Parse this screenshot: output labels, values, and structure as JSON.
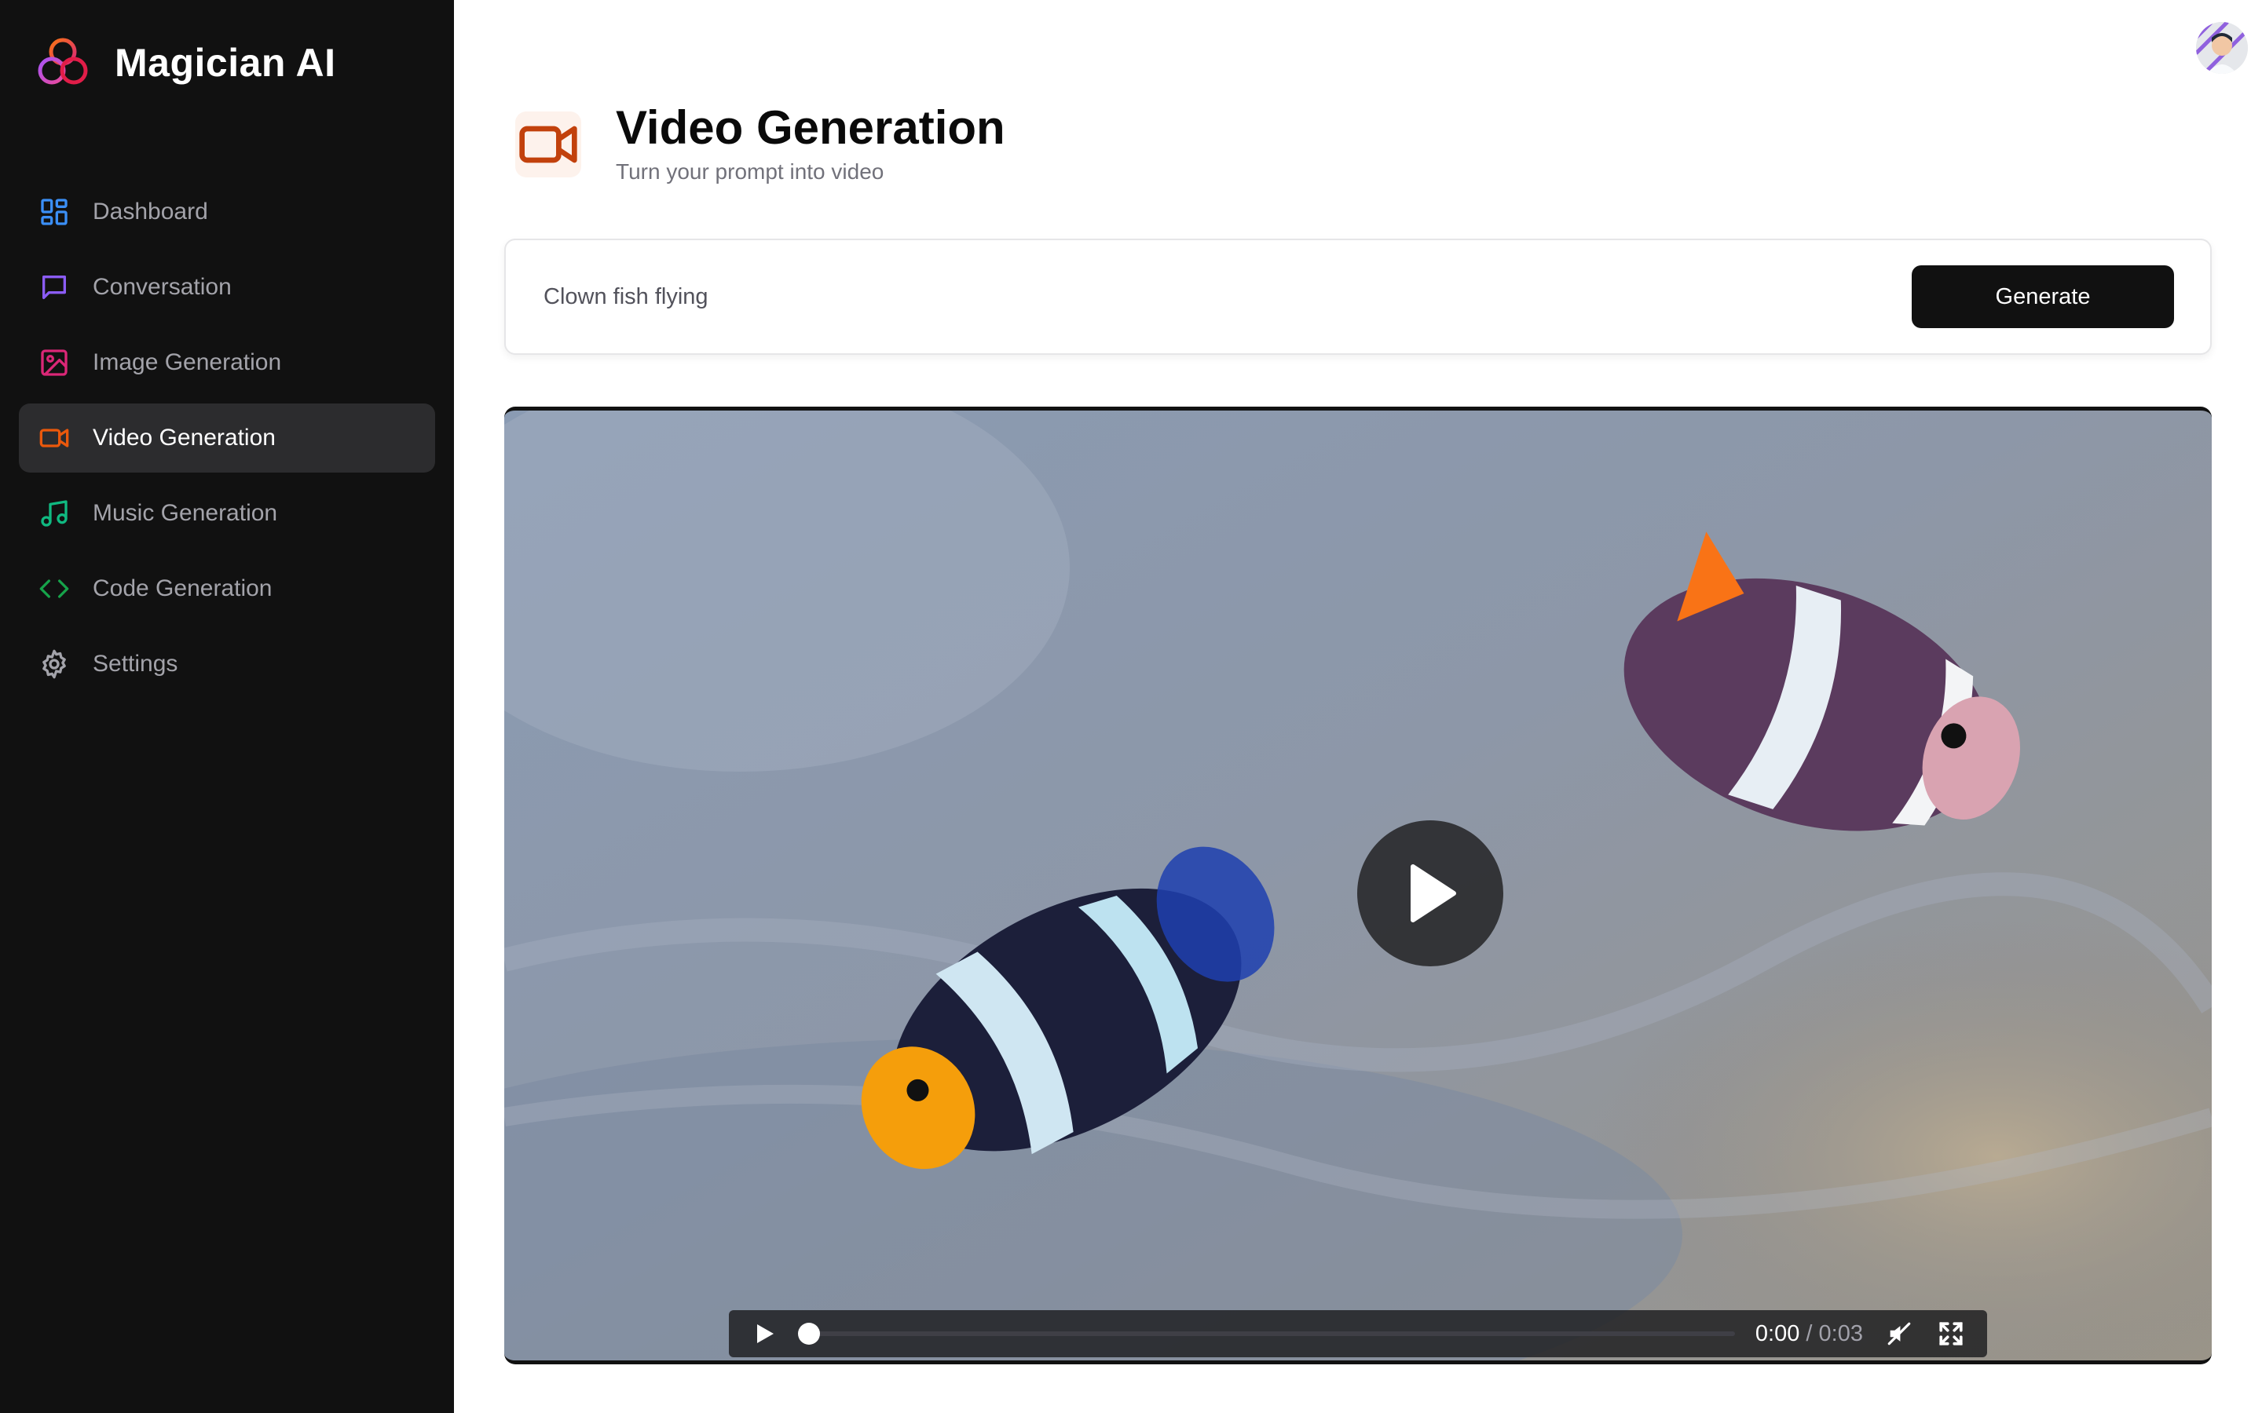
{
  "brand": {
    "name": "Magician AI"
  },
  "sidebar": {
    "items": [
      {
        "label": "Dashboard",
        "icon": "dashboard-icon",
        "color": "#3b8ff6"
      },
      {
        "label": "Conversation",
        "icon": "chat-icon",
        "color": "#8b5cf6"
      },
      {
        "label": "Image Generation",
        "icon": "image-icon",
        "color": "#db2777"
      },
      {
        "label": "Video Generation",
        "icon": "video-icon",
        "color": "#ea580c",
        "active": true
      },
      {
        "label": "Music Generation",
        "icon": "music-icon",
        "color": "#10b981"
      },
      {
        "label": "Code Generation",
        "icon": "code-icon",
        "color": "#16a34a"
      },
      {
        "label": "Settings",
        "icon": "gear-icon",
        "color": "#a3a3aa"
      }
    ]
  },
  "header": {
    "title": "Video Generation",
    "subtitle": "Turn your prompt into video",
    "icon": "video-icon",
    "accent": "#c2410c"
  },
  "prompt": {
    "value": "Clown fish flying",
    "button_label": "Generate"
  },
  "player": {
    "current_time": "0:00",
    "separator": "/",
    "duration": "0:03",
    "progress": 0.0,
    "muted": true
  }
}
